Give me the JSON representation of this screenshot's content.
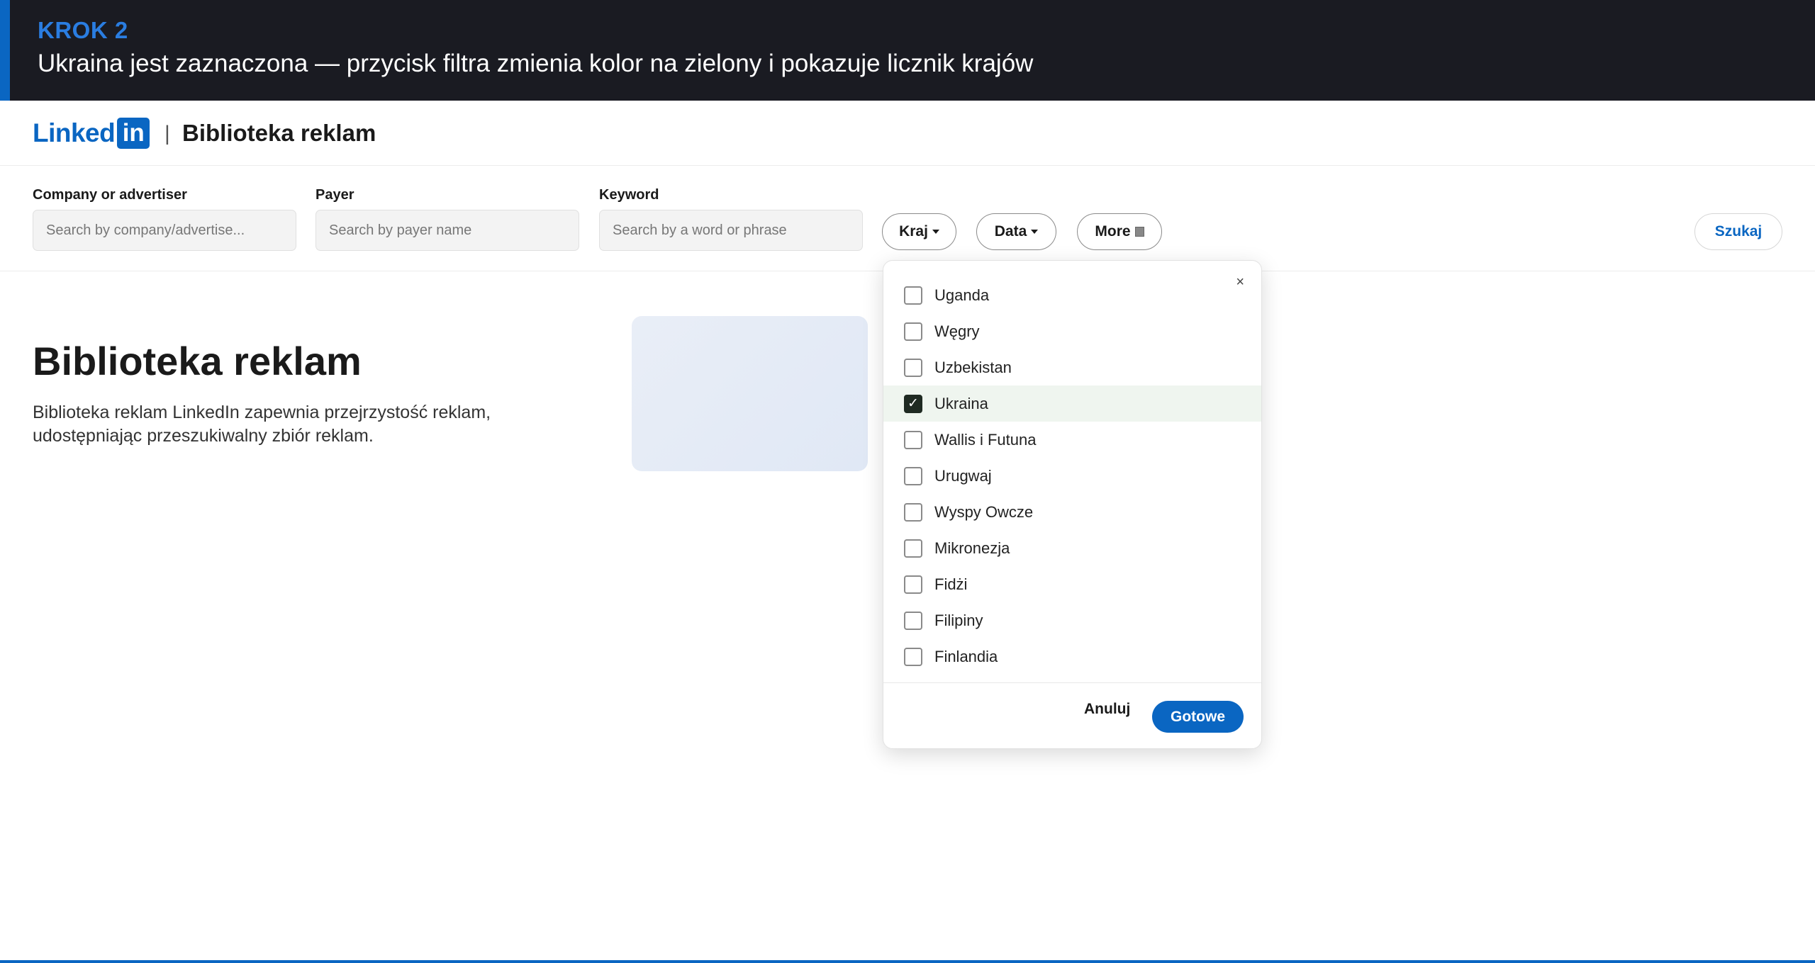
{
  "banner": {
    "step": "KROK 2",
    "title": "Ukraina jest zaznaczona — przycisk filtra zmienia kolor na zielony i pokazuje licznik krajów"
  },
  "header": {
    "logo_text": "Linked",
    "logo_box": "in",
    "separator": "|",
    "title": "Biblioteka reklam"
  },
  "filters": {
    "company": {
      "label": "Company or advertiser",
      "placeholder": "Search by company/advertise..."
    },
    "payer": {
      "label": "Payer",
      "placeholder": "Search by payer name"
    },
    "keyword": {
      "label": "Keyword",
      "placeholder": "Search by a word or phrase"
    },
    "country_pill": "Kraj",
    "date_pill": "Data",
    "more_pill": "More",
    "search_button": "Szukaj"
  },
  "hero": {
    "title": "Biblioteka reklam",
    "description": "Biblioteka reklam LinkedIn zapewnia przejrzystość reklam, udostępniając przeszukiwalny zbiór reklam."
  },
  "dropdown": {
    "close": "×",
    "options": [
      {
        "label": "Uganda",
        "checked": false
      },
      {
        "label": "Węgry",
        "checked": false
      },
      {
        "label": "Uzbekistan",
        "checked": false
      },
      {
        "label": "Ukraina",
        "checked": true
      },
      {
        "label": "Wallis i Futuna",
        "checked": false
      },
      {
        "label": "Urugwaj",
        "checked": false
      },
      {
        "label": "Wyspy Owcze",
        "checked": false
      },
      {
        "label": "Mikronezja",
        "checked": false
      },
      {
        "label": "Fidżi",
        "checked": false
      },
      {
        "label": "Filipiny",
        "checked": false
      },
      {
        "label": "Finlandia",
        "checked": false
      }
    ],
    "check_mark": "✓",
    "cancel": "Anuluj",
    "done": "Gotowe"
  },
  "colors": {
    "brand": "#0a66c2",
    "banner_bg": "#1a1b22",
    "checked_row": "#eff5ef"
  }
}
